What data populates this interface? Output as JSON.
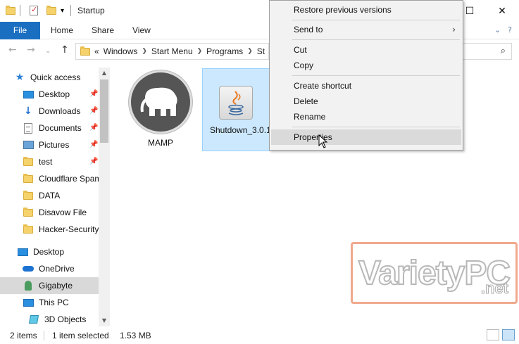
{
  "window": {
    "title": "Startup"
  },
  "ribbon": {
    "tabs": [
      "File",
      "Home",
      "Share",
      "View"
    ]
  },
  "address": {
    "overflow": "«",
    "crumbs": [
      "Windows",
      "Start Menu",
      "Programs",
      "St"
    ]
  },
  "sidebar": {
    "items": [
      {
        "label": "Quick access",
        "icon": "star-icon",
        "pinned": false
      },
      {
        "label": "Desktop",
        "icon": "desktop-icon",
        "pinned": true
      },
      {
        "label": "Downloads",
        "icon": "download-icon",
        "pinned": true
      },
      {
        "label": "Documents",
        "icon": "documents-icon",
        "pinned": true
      },
      {
        "label": "Pictures",
        "icon": "pictures-icon",
        "pinned": true
      },
      {
        "label": "test",
        "icon": "folder-icon",
        "pinned": true
      },
      {
        "label": "Cloudflare Spam",
        "icon": "folder-icon",
        "pinned": false
      },
      {
        "label": "DATA",
        "icon": "folder-icon",
        "pinned": false
      },
      {
        "label": "Disavow File",
        "icon": "folder-icon",
        "pinned": false
      },
      {
        "label": "Hacker-Security",
        "icon": "folder-icon",
        "pinned": false
      },
      {
        "label": "Desktop",
        "icon": "desktop-icon",
        "pinned": false
      },
      {
        "label": "OneDrive",
        "icon": "cloud-icon",
        "pinned": false
      },
      {
        "label": "Gigabyte",
        "icon": "user-icon",
        "pinned": false,
        "selected": true
      },
      {
        "label": "This PC",
        "icon": "pc-icon",
        "pinned": false
      },
      {
        "label": "3D Objects",
        "icon": "cube-icon",
        "pinned": false
      }
    ]
  },
  "files": [
    {
      "name": "MAMP",
      "icon": "mamp-elephant-icon"
    },
    {
      "name": "Shutdown_3.0.1",
      "icon": "java-icon",
      "selected": true
    }
  ],
  "context_menu": {
    "items": [
      "Restore previous versions",
      "Send to",
      "Cut",
      "Copy",
      "Create shortcut",
      "Delete",
      "Rename",
      "Properties"
    ],
    "highlighted": "Properties"
  },
  "watermark": {
    "text": "VarietyPC",
    "sub": ".net"
  },
  "status": {
    "items": "2 items",
    "selection": "1 item selected",
    "size": "1.53 MB"
  },
  "colors": {
    "accent": "#1a6fc1",
    "selection": "#cce8ff"
  }
}
